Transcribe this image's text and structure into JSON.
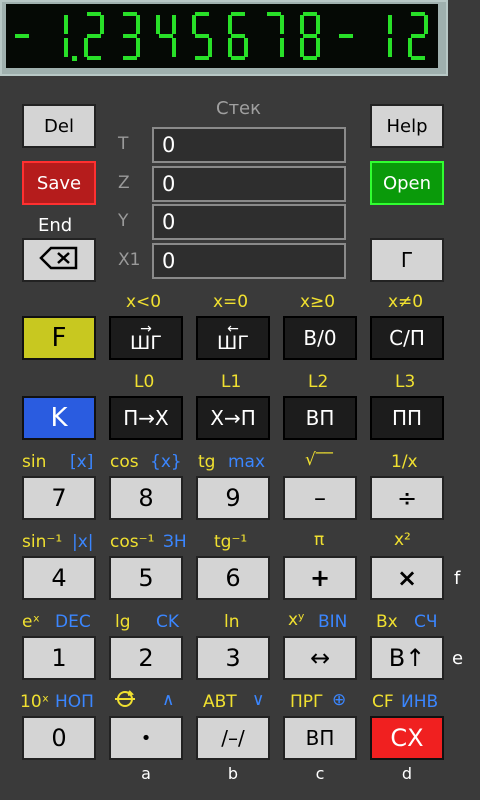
{
  "display": {
    "text": "-1.2345678-12",
    "digit_color": "#28e028",
    "background": "#050905",
    "cells": [
      "-",
      "1",
      "2",
      "3",
      "4",
      "5",
      "6",
      "7",
      "8",
      "-",
      "1",
      "2"
    ]
  },
  "stack": {
    "title": "Стек",
    "rows": [
      {
        "label": "T",
        "value": "0"
      },
      {
        "label": "Z",
        "value": "0"
      },
      {
        "label": "Y",
        "value": "0"
      },
      {
        "label": "X1",
        "value": "0"
      }
    ]
  },
  "side_buttons": {
    "del": "Del",
    "save": "Save",
    "end": "End",
    "help": "Help",
    "open": "Open",
    "gamma": "Г",
    "backspace_icon": "backspace-icon"
  },
  "row1": {
    "labels": [
      "x<0",
      "x=0",
      "x≥0",
      "x≠0"
    ],
    "buttons": [
      "F",
      "ШГ",
      "ШГ",
      "В/0",
      "С/П"
    ]
  },
  "row2": {
    "labels": [
      "L0",
      "L1",
      "L2",
      "L3"
    ],
    "buttons": [
      "K",
      "П→X",
      "X→П",
      "ВП",
      "ПП"
    ]
  },
  "row3": {
    "labels": [
      [
        "sin",
        "[x]"
      ],
      [
        "cos",
        "{x}"
      ],
      [
        "tg",
        "max"
      ],
      [
        "√‾‾",
        ""
      ],
      [
        "1/x",
        ""
      ]
    ],
    "buttons": [
      "7",
      "8",
      "9",
      "–",
      "÷"
    ]
  },
  "row4": {
    "labels": [
      [
        "sin⁻¹",
        "|x|"
      ],
      [
        "cos⁻¹",
        "ЗН"
      ],
      [
        "tg⁻¹",
        ""
      ],
      [
        "π",
        ""
      ],
      [
        "x²",
        ""
      ]
    ],
    "buttons": [
      "4",
      "5",
      "6",
      "+",
      "×"
    ],
    "side": "f"
  },
  "row5": {
    "labels": [
      [
        "eˣ",
        "DEC"
      ],
      [
        "lg",
        "CK"
      ],
      [
        "ln",
        ""
      ],
      [
        "xʸ",
        "BIN"
      ],
      [
        "Bx",
        "СЧ"
      ]
    ],
    "buttons": [
      "1",
      "2",
      "3",
      "↔",
      "B↑"
    ],
    "side": "e"
  },
  "row6": {
    "labels": [
      [
        "10ˣ",
        "НОП"
      ],
      [
        "",
        "∧"
      ],
      [
        "АВТ",
        "∨"
      ],
      [
        "ПРГ",
        "⊕"
      ],
      [
        "CF",
        "ИНВ"
      ]
    ],
    "buttons": [
      "0",
      "•",
      "/–/",
      "ВП",
      "СХ"
    ]
  },
  "bottom_letters": [
    "a",
    "b",
    "c",
    "d"
  ],
  "colors": {
    "background": "#3a3a3a",
    "yellow_label": "#f0e030",
    "blue_label": "#3a86ff",
    "f_key": "#c8c820",
    "k_key": "#2a5ce0",
    "cx_key": "#f02020",
    "save_key": "#b51c1c",
    "open_key": "#0a9a0a"
  }
}
